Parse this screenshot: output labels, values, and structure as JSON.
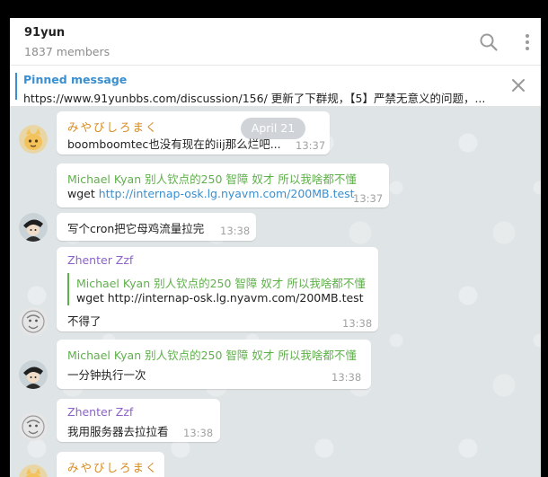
{
  "header": {
    "title": "91yun",
    "subtitle": "1837 members",
    "search_icon": "search-icon",
    "more_icon": "more-vertical-icon"
  },
  "pinned": {
    "title": "Pinned message",
    "text": "https://www.91yunbbs.com/discussion/156/ 更新了下群规，【5】严禁无意义的问题，...",
    "close_icon": "close-icon"
  },
  "date_pill": "April 21",
  "messages": [
    {
      "sender": "みやびしろまく",
      "text": "boomboomtec也没有现在的iij那么烂吧...",
      "time": "13:37"
    },
    {
      "sender": "Michael Kyan 别人钦点的250 智障 奴才 所以我啥都不懂",
      "text_prefix": "wget ",
      "link": "http://internap-osk.lg.nyavm.com/200MB.test",
      "time": "13:37"
    },
    {
      "text": "写个cron把它母鸡流量拉完",
      "time": "13:38"
    },
    {
      "sender": "Zhenter Zzf",
      "quote_sender": "Michael Kyan 别人钦点的250 智障 奴才 所以我啥都不懂",
      "quote_text": "wget http://internap-osk.lg.nyavm.com/200MB.test",
      "text": "不得了",
      "time": "13:38"
    },
    {
      "sender": "Michael Kyan 别人钦点的250 智障 奴才 所以我啥都不懂",
      "text": "一分钟执行一次",
      "time": "13:38"
    },
    {
      "sender": "Zhenter Zzf",
      "text": "我用服务器去拉拉看",
      "time": "13:38"
    },
    {
      "sender": "みやびしろまく"
    }
  ]
}
